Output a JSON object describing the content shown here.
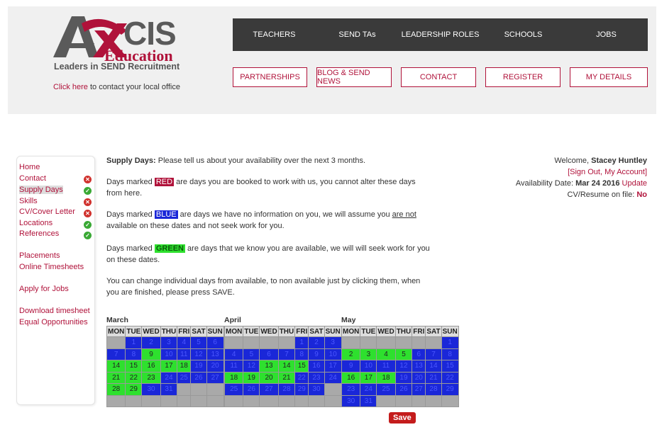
{
  "header": {
    "logo_main": "CIS",
    "logo_sub": "Education",
    "tagline": "Leaders in SEND Recruitment",
    "contact_link": "Click here",
    "contact_text": " to contact your local office"
  },
  "topnav": [
    "TEACHERS",
    "SEND TAs",
    "LEADERSHIP ROLES",
    "SCHOOLS",
    "JOBS"
  ],
  "subnav": [
    "PARTNERSHIPS",
    "BLOG & SEND NEWS",
    "CONTACT",
    "REGISTER",
    "MY DETAILS"
  ],
  "sidebar": {
    "items": [
      {
        "label": "Home",
        "status": ""
      },
      {
        "label": "Contact",
        "status": "x"
      },
      {
        "label": "Supply Days",
        "status": "ok"
      },
      {
        "label": "Skills",
        "status": "x"
      },
      {
        "label": "CV/Cover Letter",
        "status": "x"
      },
      {
        "label": "Locations",
        "status": "ok"
      },
      {
        "label": "References",
        "status": "ok"
      }
    ],
    "links2": [
      "Placements",
      "Online Timesheets"
    ],
    "links3": [
      "Apply for Jobs"
    ],
    "links4": [
      "Download timesheet",
      "Equal Opportunities"
    ]
  },
  "main": {
    "intro_bold": "Supply Days:",
    "intro_rest": " Please tell us about your availability over the next 3 months.",
    "red_pre": "Days marked ",
    "red_tag": "RED",
    "red_post": " are days you are booked to work with us, you cannot alter these days from here.",
    "blue_pre": "Days marked ",
    "blue_tag": "BLUE",
    "blue_mid": " are days we have no information on you, we will assume you ",
    "blue_ul": "are not",
    "blue_post": " available on these dates and not seek work for you.",
    "green_pre": "Days marked ",
    "green_tag": "GREEN",
    "green_post": " are days that we know you are available, we will will seek work for you on these dates.",
    "change_text": "You can change individual days from available, to non available just by clicking them, when you are finished, please press SAVE.",
    "save_label": "Save"
  },
  "account": {
    "welcome": "Welcome, ",
    "name": "Stacey Huntley",
    "sign_out": "Sign Out",
    "my_account": "My Account",
    "availability_label": "Availability Date: ",
    "availability_date": "Mar 24 2016",
    "update": "Update",
    "cv_label": "CV/Resume on file: ",
    "cv_value": "No"
  },
  "colors": {
    "accent": "#b0123a",
    "available": "#2ee02e",
    "unknown": "#1a27d8",
    "booked": "#b0123a"
  },
  "calendar": {
    "day_headers": [
      "MON",
      "TUE",
      "WED",
      "THU",
      "FRI",
      "SAT",
      "SUN"
    ],
    "months": [
      {
        "name": "March",
        "weeks": [
          [
            [
              "",
              ""
            ],
            [
              "1",
              "b"
            ],
            [
              "2",
              "b"
            ],
            [
              "3",
              "b"
            ],
            [
              "4",
              "b"
            ],
            [
              "5",
              "b"
            ],
            [
              "6",
              "b"
            ]
          ],
          [
            [
              "7",
              "b"
            ],
            [
              "8",
              "b"
            ],
            [
              "9",
              "g"
            ],
            [
              "10",
              "b"
            ],
            [
              "11",
              "b"
            ],
            [
              "12",
              "b"
            ],
            [
              "13",
              "b"
            ]
          ],
          [
            [
              "14",
              "g"
            ],
            [
              "15",
              "g"
            ],
            [
              "16",
              "g"
            ],
            [
              "17",
              "g"
            ],
            [
              "18",
              "g"
            ],
            [
              "19",
              "b"
            ],
            [
              "20",
              "b"
            ]
          ],
          [
            [
              "21",
              "g"
            ],
            [
              "22",
              "g"
            ],
            [
              "23",
              "g"
            ],
            [
              "24",
              "b"
            ],
            [
              "25",
              "b"
            ],
            [
              "26",
              "b"
            ],
            [
              "27",
              "b"
            ]
          ],
          [
            [
              "28",
              "g"
            ],
            [
              "29",
              "g"
            ],
            [
              "30",
              "b"
            ],
            [
              "31",
              "b"
            ],
            [
              "",
              ""
            ],
            [
              "",
              ""
            ],
            [
              "",
              ""
            ]
          ],
          [
            [
              "",
              ""
            ],
            [
              "",
              ""
            ],
            [
              "",
              ""
            ],
            [
              "",
              ""
            ],
            [
              "",
              ""
            ],
            [
              "",
              ""
            ],
            [
              "",
              ""
            ]
          ]
        ]
      },
      {
        "name": "April",
        "weeks": [
          [
            [
              "",
              ""
            ],
            [
              "",
              ""
            ],
            [
              "",
              ""
            ],
            [
              "",
              ""
            ],
            [
              "1",
              "b"
            ],
            [
              "2",
              "b"
            ],
            [
              "3",
              "b"
            ]
          ],
          [
            [
              "4",
              "b"
            ],
            [
              "5",
              "b"
            ],
            [
              "6",
              "b"
            ],
            [
              "7",
              "b"
            ],
            [
              "8",
              "b"
            ],
            [
              "9",
              "b"
            ],
            [
              "10",
              "b"
            ]
          ],
          [
            [
              "11",
              "b"
            ],
            [
              "12",
              "b"
            ],
            [
              "13",
              "g"
            ],
            [
              "14",
              "g"
            ],
            [
              "15",
              "g"
            ],
            [
              "16",
              "b"
            ],
            [
              "17",
              "b"
            ]
          ],
          [
            [
              "18",
              "g"
            ],
            [
              "19",
              "g"
            ],
            [
              "20",
              "g"
            ],
            [
              "21",
              "g"
            ],
            [
              "22",
              "b"
            ],
            [
              "23",
              "b"
            ],
            [
              "24",
              "b"
            ]
          ],
          [
            [
              "25",
              "b"
            ],
            [
              "26",
              "b"
            ],
            [
              "27",
              "b"
            ],
            [
              "28",
              "b"
            ],
            [
              "29",
              "b"
            ],
            [
              "30",
              "b"
            ],
            [
              "",
              ""
            ]
          ],
          [
            [
              "",
              ""
            ],
            [
              "",
              ""
            ],
            [
              "",
              ""
            ],
            [
              "",
              ""
            ],
            [
              "",
              ""
            ],
            [
              "",
              ""
            ],
            [
              "",
              ""
            ]
          ]
        ]
      },
      {
        "name": "May",
        "weeks": [
          [
            [
              "",
              ""
            ],
            [
              "",
              ""
            ],
            [
              "",
              ""
            ],
            [
              "",
              ""
            ],
            [
              "",
              ""
            ],
            [
              "",
              ""
            ],
            [
              "1",
              "b"
            ]
          ],
          [
            [
              "2",
              "g"
            ],
            [
              "3",
              "g"
            ],
            [
              "4",
              "g"
            ],
            [
              "5",
              "g"
            ],
            [
              "6",
              "b"
            ],
            [
              "7",
              "b"
            ],
            [
              "8",
              "b"
            ]
          ],
          [
            [
              "9",
              "b"
            ],
            [
              "10",
              "b"
            ],
            [
              "11",
              "b"
            ],
            [
              "12",
              "b"
            ],
            [
              "13",
              "b"
            ],
            [
              "14",
              "b"
            ],
            [
              "15",
              "b"
            ]
          ],
          [
            [
              "16",
              "g"
            ],
            [
              "17",
              "g"
            ],
            [
              "18",
              "g"
            ],
            [
              "19",
              "b"
            ],
            [
              "20",
              "b"
            ],
            [
              "21",
              "b"
            ],
            [
              "22",
              "b"
            ]
          ],
          [
            [
              "23",
              "b"
            ],
            [
              "24",
              "b"
            ],
            [
              "25",
              "b"
            ],
            [
              "26",
              "b"
            ],
            [
              "27",
              "b"
            ],
            [
              "28",
              "b"
            ],
            [
              "29",
              "b"
            ]
          ],
          [
            [
              "30",
              "b"
            ],
            [
              "31",
              "b"
            ],
            [
              "",
              ""
            ],
            [
              "",
              ""
            ],
            [
              "",
              ""
            ],
            [
              "",
              ""
            ],
            [
              "",
              ""
            ]
          ]
        ]
      }
    ]
  }
}
